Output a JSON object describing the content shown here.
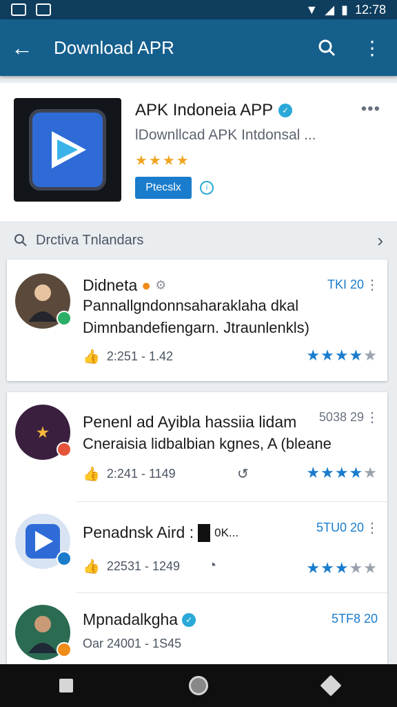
{
  "status_bar": {
    "time": "12:78"
  },
  "app_bar": {
    "title": "Download APR"
  },
  "hero": {
    "title": "APK Indoneia APP",
    "subtitle": "lDownllcad APK Intdonsal ...",
    "stars": "★★★★",
    "button_label": "Ptecslx",
    "more": "•••",
    "accent": "#1a7ccc",
    "star_color": "#f0a522"
  },
  "search": {
    "label": "Drctiva Tnlandars"
  },
  "items": [
    {
      "title": "Didneta",
      "desc1": "Pannallgndonnsaharaklaha dkal",
      "desc2": "Dimnbandefiengarn. Jtraunlenkls)",
      "meta": "2:251 - 1.42",
      "size": "TKI 20",
      "rating": 4
    },
    {
      "title": "Penenl ad Ayibla hassiia lidam",
      "desc1": "Cneraisia lidbalbian kgnes, A (bleane",
      "meta": "2:241 - 1149",
      "size": "5038 29",
      "rating": 4
    },
    {
      "title": "Penadnsk Aird :",
      "extra": "0K...",
      "meta": "22531 - 1249",
      "size": "5TU0 20",
      "rating": 3
    },
    {
      "title": "Mpnadalkgha",
      "meta": "Oar 24001 - 1S45",
      "size": "5TF8 20"
    }
  ]
}
